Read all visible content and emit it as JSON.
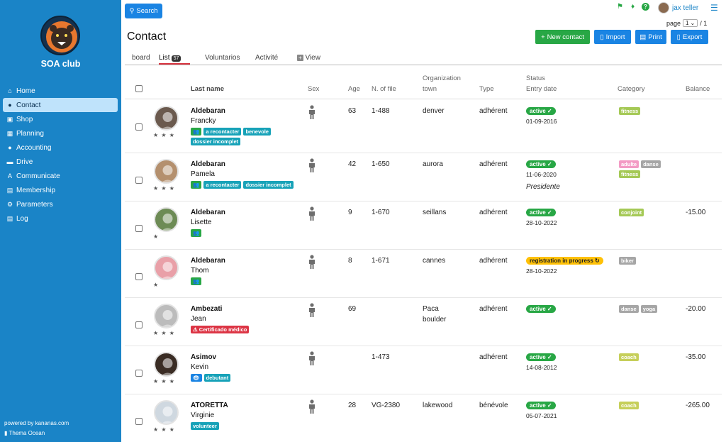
{
  "sidebar": {
    "club_name": "SOA club",
    "items": [
      {
        "label": "Home",
        "icon": "home-icon",
        "glyph": "⌂"
      },
      {
        "label": "Contact",
        "icon": "users-icon",
        "glyph": "👥"
      },
      {
        "label": "Shop",
        "icon": "cart-icon",
        "glyph": "🛒"
      },
      {
        "label": "Planning",
        "icon": "calendar-icon",
        "glyph": "▦"
      },
      {
        "label": "Accounting",
        "icon": "piggy-bank-icon",
        "glyph": "●"
      },
      {
        "label": "Drive",
        "icon": "drive-icon",
        "glyph": "▬"
      },
      {
        "label": "Communicate",
        "icon": "translate-icon",
        "glyph": "A"
      },
      {
        "label": "Membership",
        "icon": "id-card-icon",
        "glyph": "▤"
      },
      {
        "label": "Parameters",
        "icon": "gear-icon",
        "glyph": "⚙"
      },
      {
        "label": "Log",
        "icon": "log-icon",
        "glyph": "▤"
      }
    ],
    "powered": "powered by kananas.com",
    "theme": "Thema Ocean"
  },
  "topbar": {
    "search_label": "Search",
    "user_name": "jax teller",
    "page_label": "page",
    "page_value": "1",
    "page_total": "/ 1"
  },
  "page": {
    "title": "Contact",
    "actions": {
      "new_contact": "New contact",
      "import": "Import",
      "print": "Print",
      "export": "Export"
    }
  },
  "tabs": {
    "board": "board",
    "list": "List",
    "list_count": "57",
    "voluntarios": "Voluntarios",
    "activite": "Activité",
    "view": "View"
  },
  "columns": {
    "last_name": "Last name",
    "sex": "Sex",
    "age": "Age",
    "file": "N. of file",
    "org": "Organization",
    "town": "town",
    "type": "Type",
    "status": "Status",
    "entry": "Entry date",
    "category": "Category",
    "balance": "Balance"
  },
  "colors": {
    "sidebar": "#1a84c7",
    "green": "#28a745",
    "blue": "#1a84e3",
    "teal": "#17a2b8",
    "red": "#dc3545",
    "yellow": "#ffc107"
  },
  "rows": [
    {
      "last": "Aldebaran",
      "first": "Francky",
      "stars": "★ ★ ★",
      "age": "63",
      "file": "1-488",
      "town": "denver",
      "town2": "",
      "type": "adhérent",
      "status": "active ✓",
      "date": "01-09-2016",
      "role": "",
      "balance": "",
      "tags": [
        {
          "t": "👥",
          "c": "green"
        },
        {
          "t": "a recontacter",
          "c": "teal"
        },
        {
          "t": "benevole",
          "c": "teal"
        },
        {
          "t": "dossier incomplet",
          "c": "teal"
        }
      ],
      "cats": [
        {
          "t": "fitness",
          "c": "#a5c956"
        }
      ]
    },
    {
      "last": "Aldebaran",
      "first": "Pamela",
      "stars": "★ ★ ★",
      "age": "42",
      "file": "1-650",
      "town": "aurora",
      "town2": "",
      "type": "adhérent",
      "status": "active ✓",
      "date": "11-06-2020",
      "role": "Presidente",
      "balance": "",
      "tags": [
        {
          "t": "👥",
          "c": "green"
        },
        {
          "t": "a recontacter",
          "c": "teal"
        },
        {
          "t": "dossier incomplet",
          "c": "teal"
        }
      ],
      "cats": [
        {
          "t": "adulte",
          "c": "#f39bc5"
        },
        {
          "t": "danse",
          "c": "#a6a6a6"
        },
        {
          "t": "fitness",
          "c": "#a5c956"
        }
      ]
    },
    {
      "last": "Aldebaran",
      "first": "Lisette",
      "stars": "★",
      "age": "9",
      "file": "1-670",
      "town": "seillans",
      "town2": "",
      "type": "adhérent",
      "status": "active ✓",
      "date": "28-10-2022",
      "role": "",
      "balance": "-15.00",
      "tags": [
        {
          "t": "👥",
          "c": "green"
        }
      ],
      "cats": [
        {
          "t": "conjoint",
          "c": "#a5c956"
        }
      ]
    },
    {
      "last": "Aldebaran",
      "first": "Thom",
      "stars": "★",
      "age": "8",
      "file": "1-671",
      "town": "cannes",
      "town2": "",
      "type": "adhérent",
      "status": "registration in progress ↻",
      "date": "28-10-2022",
      "role": "",
      "balance": "",
      "tags": [
        {
          "t": "👥",
          "c": "green"
        }
      ],
      "cats": [
        {
          "t": "biker",
          "c": "#a6a6a6"
        }
      ]
    },
    {
      "last": "Ambezati",
      "first": "Jean",
      "stars": "★ ★ ★",
      "age": "69",
      "file": "",
      "town": "Paca",
      "town2": "boulder",
      "type": "adhérent",
      "status": "active ✓",
      "date": "",
      "role": "",
      "balance": "-20.00",
      "tags": [
        {
          "t": "⚠ Certificado médico",
          "c": "red"
        }
      ],
      "cats": [
        {
          "t": "danse",
          "c": "#a6a6a6"
        },
        {
          "t": "yoga",
          "c": "#a6a6a6"
        }
      ]
    },
    {
      "last": "Asimov",
      "first": "Kevin",
      "stars": "★ ★ ★",
      "age": "",
      "file": "1-473",
      "town": "",
      "town2": "",
      "type": "adhérent",
      "status": "active ✓",
      "date": "14-08-2012",
      "role": "",
      "balance": "-35.00",
      "tags": [
        {
          "t": "👁",
          "c": "blue"
        },
        {
          "t": "debutant",
          "c": "teal"
        }
      ],
      "cats": [
        {
          "t": "coach",
          "c": "#c6cf5a"
        }
      ]
    },
    {
      "last": "ATORETTA",
      "first": "Virginie",
      "stars": "★ ★ ★",
      "age": "28",
      "file": "VG-2380",
      "town": "lakewood",
      "town2": "",
      "type": "bénévole",
      "status": "active ✓",
      "date": "05-07-2021",
      "role": "",
      "balance": "-265.00",
      "tags": [
        {
          "t": "volunteer",
          "c": "teal"
        }
      ],
      "cats": [
        {
          "t": "coach",
          "c": "#c6cf5a"
        }
      ]
    }
  ]
}
